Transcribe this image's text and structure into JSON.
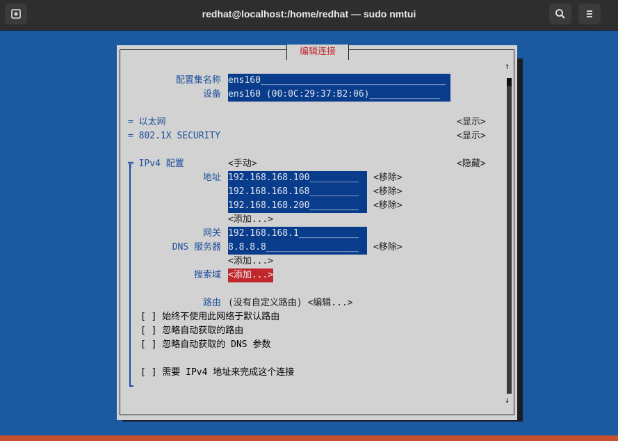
{
  "window": {
    "title": "redhat@localhost:/home/redhat — sudo nmtui",
    "new_tab_icon": "new-tab-icon",
    "search_icon": "search-icon",
    "menu_icon": "hamburger-menu-icon"
  },
  "dialog": {
    "title": "编辑连接",
    "profile_name_label": "配置集名称",
    "profile_name_value": "ens160__________________________________",
    "device_label": "设备",
    "device_value": "ens160 (00:0C:29:37:B2:06)_____________",
    "ethernet_label": "= 以太网",
    "ethernet_toggle": "<显示>",
    "security_label": "= 802.1X SECURITY",
    "security_toggle": "<显示>",
    "ipv4_label": "╤ IPv4 配置",
    "ipv4_method": "<手动>",
    "ipv4_toggle": "<隐藏>",
    "address_label": "地址",
    "addresses": [
      {
        "value": "192.168.168.100_________",
        "remove": "<移除>"
      },
      {
        "value": "192.168.168.168_________",
        "remove": "<移除>"
      },
      {
        "value": "192.168.168.200_________",
        "remove": "<移除>"
      }
    ],
    "address_add": "<添加...>",
    "gateway_label": "网关",
    "gateway_value": "192.168.168.1___________",
    "dns_label": "DNS 服务器",
    "dns_value": "8.8.8.8_________________",
    "dns_remove": "<移除>",
    "dns_add": "<添加...>",
    "search_label": "搜索域",
    "search_add": "<添加...>",
    "routing_label": "路由",
    "routing_value": "(没有自定义路由) <编辑...>",
    "checks": [
      "[ ] 始终不使用此网络于默认路由",
      "[ ] 忽略自动获取的路由",
      "[ ] 忽略自动获取的 DNS 参数",
      "[ ] 需要 IPv4 地址来完成这个连接"
    ],
    "scroll_up": "↑",
    "scroll_down": "↓"
  }
}
